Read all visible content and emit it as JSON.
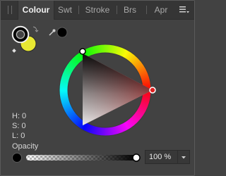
{
  "tabs": [
    {
      "label": "Colour",
      "active": true
    },
    {
      "label": "Swt",
      "active": false
    },
    {
      "label": "Stroke",
      "active": false
    },
    {
      "label": "Brs",
      "active": false
    },
    {
      "label": "Apr",
      "active": false
    }
  ],
  "readouts": {
    "h": "H: 0",
    "s": "S: 0",
    "l": "L: 0"
  },
  "opacity": {
    "label": "Opacity",
    "value": "100 %",
    "fraction": 1.0
  },
  "colors": {
    "fill": "#e8e832",
    "stroke": "#000000",
    "picked": "#000000",
    "hue_marker": "#e02020"
  },
  "icons": [
    "menu-icon",
    "swap-colors-icon",
    "eyedropper-icon",
    "reset-colors-icon",
    "chevron-down-icon"
  ]
}
